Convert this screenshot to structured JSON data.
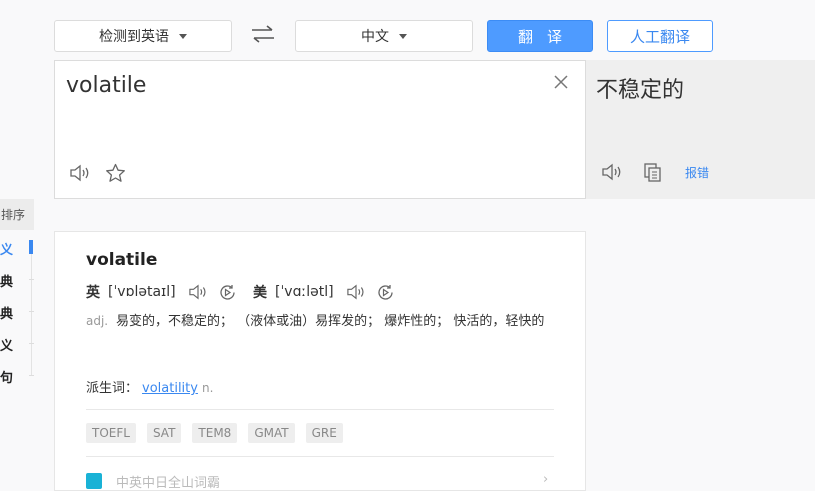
{
  "toolbar": {
    "source_lang": "检测到英语",
    "target_lang": "中文",
    "translate_label": "翻译",
    "human_translate_label": "人工翻译"
  },
  "source": {
    "text": "volatile"
  },
  "result": {
    "text": "不稳定的",
    "report_label": "报错"
  },
  "sidebar": {
    "header": "排序",
    "items": [
      "义",
      "典",
      "典",
      "义",
      "句"
    ]
  },
  "dict": {
    "word": "volatile",
    "uk_label": "英",
    "uk_ipa": "[ˈvɒlətaɪl]",
    "us_label": "美",
    "us_ipa": "[ˈvɑːlətl]",
    "pos": "adj.",
    "meaning": "易变的，不稳定的； （液体或油）易挥发的； 爆炸性的； 快活的，轻快的",
    "derive_label": "派生词：",
    "derive_word": "volatility",
    "derive_pos": "n.",
    "tags": [
      "TOEFL",
      "SAT",
      "TEM8",
      "GMAT",
      "GRE"
    ],
    "partner_text": "中英中日全山词霸"
  },
  "colors": {
    "accent": "#4e9bff",
    "link": "#3a88f0"
  }
}
